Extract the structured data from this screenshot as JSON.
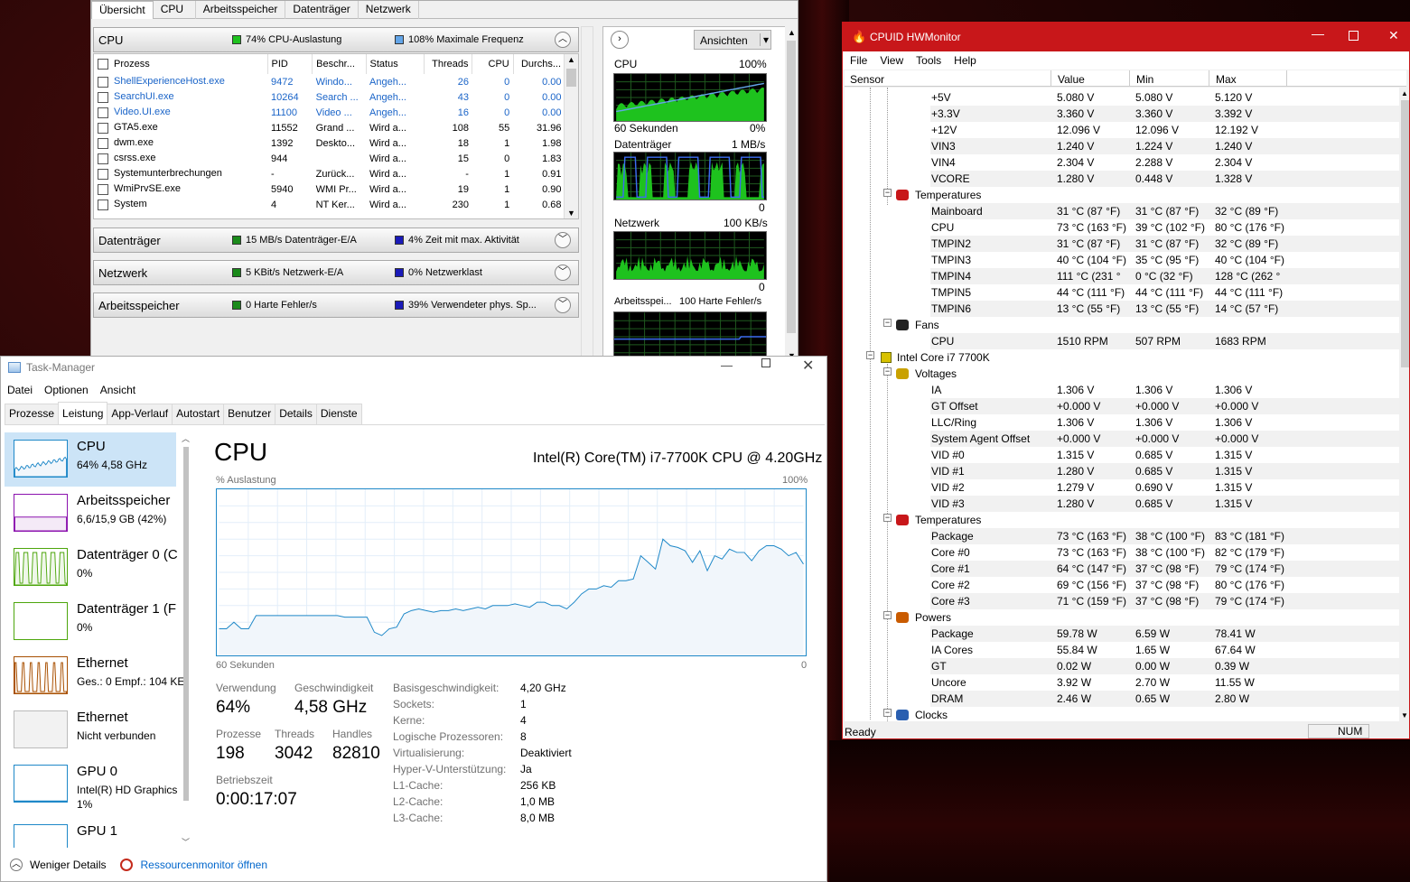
{
  "rm": {
    "tabs": [
      "Übersicht",
      "CPU",
      "Arbeitsspeicher",
      "Datenträger",
      "Netzwerk"
    ],
    "cpu": {
      "title": "CPU",
      "info1": "74% CPU-Auslastung",
      "info2": "108% Maximale Frequenz"
    },
    "columns": [
      "Prozess",
      "PID",
      "Beschr...",
      "Status",
      "Threads",
      "CPU",
      "Durchs..."
    ],
    "rows": [
      [
        "ShellExperienceHost.exe",
        "9472",
        "Windo...",
        "Angeh...",
        "26",
        "0",
        "0.00"
      ],
      [
        "SearchUI.exe",
        "10264",
        "Search ...",
        "Angeh...",
        "43",
        "0",
        "0.00"
      ],
      [
        "Video.UI.exe",
        "11100",
        "Video ...",
        "Angeh...",
        "16",
        "0",
        "0.00"
      ],
      [
        "GTA5.exe",
        "11552",
        "Grand ...",
        "Wird a...",
        "108",
        "55",
        "31.96"
      ],
      [
        "dwm.exe",
        "1392",
        "Deskto...",
        "Wird a...",
        "18",
        "1",
        "1.98"
      ],
      [
        "csrss.exe",
        "944",
        "",
        "Wird a...",
        "15",
        "0",
        "1.83"
      ],
      [
        "Systemunterbrechungen",
        "-",
        "Zurück...",
        "Wird a...",
        "-",
        "1",
        "0.91"
      ],
      [
        "WmiPrvSE.exe",
        "5940",
        "WMI Pr...",
        "Wird a...",
        "19",
        "1",
        "0.90"
      ],
      [
        "System",
        "4",
        "NT Ker...",
        "Wird a...",
        "230",
        "1",
        "0.68"
      ]
    ],
    "disk": {
      "title": "Datenträger",
      "info1": "15 MB/s Datenträger-E/A",
      "info2": "4% Zeit mit max. Aktivität"
    },
    "net": {
      "title": "Netzwerk",
      "info1": "5 KBit/s Netzwerk-E/A",
      "info2": "0% Netzwerklast"
    },
    "mem": {
      "title": "Arbeitsspeicher",
      "info1": "0 Harte Fehler/s",
      "info2": "39% Verwendeter phys. Sp..."
    },
    "ansichten": "Ansichten",
    "graphs": {
      "cpu_label": "CPU",
      "cpu_max": "100%",
      "cpu_time": "60 Sekunden",
      "cpu_min": "0%",
      "disk_label": "Datenträger",
      "disk_max": "1 MB/s",
      "disk_min": "0",
      "net_label": "Netzwerk",
      "net_max": "100 KB/s",
      "net_min": "0",
      "mem_label": "Arbeitsspei...",
      "mem_max": "100 Harte Fehler/s"
    },
    "colors": {
      "green": "#1ec21e",
      "blue": "#1a1ab8",
      "lightblue": "#63a5e8"
    }
  },
  "tm": {
    "title": "Task-Manager",
    "menu": [
      "Datei",
      "Optionen",
      "Ansicht"
    ],
    "tabs": [
      "Prozesse",
      "Leistung",
      "App-Verlauf",
      "Autostart",
      "Benutzer",
      "Details",
      "Dienste"
    ],
    "side": [
      {
        "name": "CPU",
        "sub": "64% 4,58 GHz"
      },
      {
        "name": "Arbeitsspeicher",
        "sub": "6,6/15,9 GB (42%)"
      },
      {
        "name": "Datenträger 0 (C",
        "sub": "0%"
      },
      {
        "name": "Datenträger 1 (F",
        "sub": "0%"
      },
      {
        "name": "Ethernet",
        "sub": "Ges.: 0 Empf.: 104 KE"
      },
      {
        "name": "Ethernet",
        "sub": "Nicht verbunden"
      },
      {
        "name": "GPU 0",
        "sub": "Intel(R) HD Graphics",
        "sub2": "1%"
      },
      {
        "name": "GPU 1",
        "sub": ""
      }
    ],
    "main": {
      "title": "CPU",
      "cpu_name": "Intel(R) Core(TM) i7-7700K CPU @ 4.20GHz",
      "graph_label": "% Auslastung",
      "graph_max": "100%",
      "graph_time": "60 Sekunden",
      "graph_min": "0",
      "verwendung_l": "Verwendung",
      "verwendung": "64%",
      "geschw_l": "Geschwindigkeit",
      "geschw": "4,58 GHz",
      "prozesse_l": "Prozesse",
      "prozesse": "198",
      "threads_l": "Threads",
      "threads": "3042",
      "handles_l": "Handles",
      "handles": "82810",
      "betrieb_l": "Betriebszeit",
      "betrieb": "0:00:17:07",
      "details": [
        [
          "Basisgeschwindigkeit:",
          "4,20 GHz"
        ],
        [
          "Sockets:",
          "1"
        ],
        [
          "Kerne:",
          "4"
        ],
        [
          "Logische Prozessoren:",
          "8"
        ],
        [
          "Virtualisierung:",
          "Deaktiviert"
        ],
        [
          "Hyper-V-Unterstützung:",
          "Ja"
        ],
        [
          "L1-Cache:",
          "256 KB"
        ],
        [
          "L2-Cache:",
          "1,0 MB"
        ],
        [
          "L3-Cache:",
          "8,0 MB"
        ]
      ]
    },
    "footer": {
      "less": "Weniger Details",
      "resmon": "Ressourcenmonitor öffnen"
    },
    "cpu_history": [
      16,
      16,
      20,
      16,
      16,
      24,
      24,
      24,
      24,
      24,
      24,
      24,
      24,
      24,
      24,
      24,
      24,
      23,
      23,
      23,
      23,
      14,
      12,
      16,
      17,
      25,
      27,
      28,
      27,
      26,
      27,
      27,
      28,
      27,
      28,
      29,
      28,
      30,
      30,
      30,
      31,
      30,
      29,
      32,
      32,
      30,
      30,
      28,
      32,
      37,
      40,
      40,
      42,
      41,
      45,
      45,
      46,
      60,
      56,
      52,
      70,
      66,
      65,
      63,
      56,
      63,
      51,
      60,
      58,
      64,
      62,
      62,
      57,
      63,
      66,
      66,
      64,
      60,
      62,
      55
    ]
  },
  "hw": {
    "title": "CPUID HWMonitor",
    "menu": [
      "File",
      "View",
      "Tools",
      "Help"
    ],
    "cols": [
      "Sensor",
      "Value",
      "Min",
      "Max"
    ],
    "status": "Ready",
    "num": "NUM",
    "rows": [
      {
        "name": "+5V",
        "v": "5.080 V",
        "mi": "5.080 V",
        "ma": "5.120 V"
      },
      {
        "name": "+3.3V",
        "v": "3.360 V",
        "mi": "3.360 V",
        "ma": "3.392 V"
      },
      {
        "name": "+12V",
        "v": "12.096 V",
        "mi": "12.096 V",
        "ma": "12.192 V"
      },
      {
        "name": "VIN3",
        "v": "1.240 V",
        "mi": "1.224 V",
        "ma": "1.240 V"
      },
      {
        "name": "VIN4",
        "v": "2.304 V",
        "mi": "2.288 V",
        "ma": "2.304 V"
      },
      {
        "name": "VCORE",
        "v": "1.280 V",
        "mi": "0.448 V",
        "ma": "1.328 V"
      },
      {
        "group": "Temperatures",
        "icon": "temp"
      },
      {
        "name": "Mainboard",
        "v": "31 °C  (87 °F)",
        "mi": "31 °C  (87 °F)",
        "ma": "32 °C  (89 °F)"
      },
      {
        "name": "CPU",
        "v": "73 °C  (163 °F)",
        "mi": "39 °C  (102 °F)",
        "ma": "80 °C  (176 °F)"
      },
      {
        "name": "TMPIN2",
        "v": "31 °C  (87 °F)",
        "mi": "31 °C  (87 °F)",
        "ma": "32 °C  (89 °F)"
      },
      {
        "name": "TMPIN3",
        "v": "40 °C  (104 °F)",
        "mi": "35 °C  (95 °F)",
        "ma": "40 °C  (104 °F)"
      },
      {
        "name": "TMPIN4",
        "v": "111 °C  (231 °",
        "mi": "0 °C  (32 °F)",
        "ma": "128 °C  (262 °"
      },
      {
        "name": "TMPIN5",
        "v": "44 °C  (111 °F)",
        "mi": "44 °C  (111 °F)",
        "ma": "44 °C  (111 °F)"
      },
      {
        "name": "TMPIN6",
        "v": "13 °C  (55 °F)",
        "mi": "13 °C  (55 °F)",
        "ma": "14 °C  (57 °F)"
      },
      {
        "group": "Fans",
        "icon": "fan"
      },
      {
        "name": "CPU",
        "v": "1510 RPM",
        "mi": "507 RPM",
        "ma": "1683 RPM"
      },
      {
        "device": "Intel Core i7 7700K"
      },
      {
        "group": "Voltages",
        "icon": "volt"
      },
      {
        "name": "IA",
        "v": "1.306 V",
        "mi": "1.306 V",
        "ma": "1.306 V"
      },
      {
        "name": "GT Offset",
        "v": "+0.000 V",
        "mi": "+0.000 V",
        "ma": "+0.000 V"
      },
      {
        "name": "LLC/Ring",
        "v": "1.306 V",
        "mi": "1.306 V",
        "ma": "1.306 V"
      },
      {
        "name": "System Agent Offset",
        "v": "+0.000 V",
        "mi": "+0.000 V",
        "ma": "+0.000 V"
      },
      {
        "name": "VID #0",
        "v": "1.315 V",
        "mi": "0.685 V",
        "ma": "1.315 V"
      },
      {
        "name": "VID #1",
        "v": "1.280 V",
        "mi": "0.685 V",
        "ma": "1.315 V"
      },
      {
        "name": "VID #2",
        "v": "1.279 V",
        "mi": "0.690 V",
        "ma": "1.315 V"
      },
      {
        "name": "VID #3",
        "v": "1.280 V",
        "mi": "0.685 V",
        "ma": "1.315 V"
      },
      {
        "group": "Temperatures",
        "icon": "temp"
      },
      {
        "name": "Package",
        "v": "73 °C  (163 °F)",
        "mi": "38 °C  (100 °F)",
        "ma": "83 °C  (181 °F)"
      },
      {
        "name": "Core #0",
        "v": "73 °C  (163 °F)",
        "mi": "38 °C  (100 °F)",
        "ma": "82 °C  (179 °F)"
      },
      {
        "name": "Core #1",
        "v": "64 °C  (147 °F)",
        "mi": "37 °C  (98 °F)",
        "ma": "79 °C  (174 °F)"
      },
      {
        "name": "Core #2",
        "v": "69 °C  (156 °F)",
        "mi": "37 °C  (98 °F)",
        "ma": "80 °C  (176 °F)"
      },
      {
        "name": "Core #3",
        "v": "71 °C  (159 °F)",
        "mi": "37 °C  (98 °F)",
        "ma": "79 °C  (174 °F)"
      },
      {
        "group": "Powers",
        "icon": "power"
      },
      {
        "name": "Package",
        "v": "59.78 W",
        "mi": "6.59 W",
        "ma": "78.41 W"
      },
      {
        "name": "IA Cores",
        "v": "55.84 W",
        "mi": "1.65 W",
        "ma": "67.64 W"
      },
      {
        "name": "GT",
        "v": "0.02 W",
        "mi": "0.00 W",
        "ma": "0.39 W"
      },
      {
        "name": "Uncore",
        "v": "3.92 W",
        "mi": "2.70 W",
        "ma": "11.55 W"
      },
      {
        "name": "DRAM",
        "v": "2.46 W",
        "mi": "0.65 W",
        "ma": "2.80 W"
      },
      {
        "group": "Clocks",
        "icon": "clock"
      }
    ]
  }
}
